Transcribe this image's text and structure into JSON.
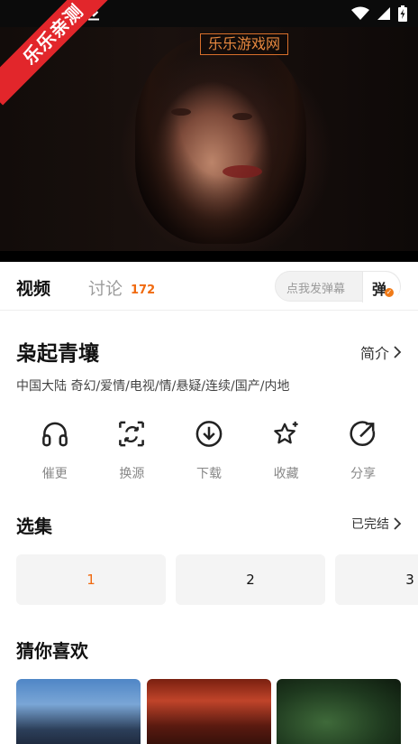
{
  "overlay": {
    "corner_badge": "乐乐亲测",
    "watermark": "乐乐游戏网"
  },
  "tabs": {
    "video": "视频",
    "discussion": "讨论",
    "discussion_count": "172",
    "danmaku_placeholder": "点我发弹幕",
    "danmaku_button": "弹"
  },
  "show": {
    "title": "枭起青壤",
    "intro_label": "简介",
    "tags": "中国大陆  奇幻/爱情/电视/情/悬疑/连续/国产/内地"
  },
  "actions": [
    {
      "label": "催更",
      "icon": "headphones-icon"
    },
    {
      "label": "换源",
      "icon": "switch-source-icon"
    },
    {
      "label": "下载",
      "icon": "download-circle-icon"
    },
    {
      "label": "收藏",
      "icon": "star-sparkle-icon"
    },
    {
      "label": "分享",
      "icon": "share-arrow-icon"
    }
  ],
  "episodes": {
    "title": "选集",
    "status": "已完结",
    "items": [
      "1",
      "2",
      "3"
    ],
    "active_color": "#f06a10"
  },
  "recommend": {
    "title": "猜你喜欢"
  },
  "colors": {
    "accent": "#f06a10",
    "corner_badge_bg": "#e2262b"
  }
}
